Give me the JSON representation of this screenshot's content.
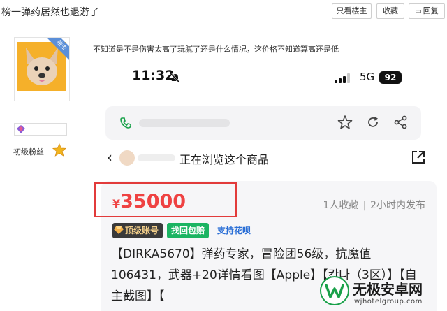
{
  "topbar": {
    "title": "榜一弹药居然也退游了",
    "only_op_label": "只看楼主",
    "favorite_label": "收藏",
    "reply_label": "回复"
  },
  "author": {
    "op_badge": "楼主",
    "level_label": "初级粉丝"
  },
  "post": {
    "text": "不知道是不是伤害太高了玩腻了还是什么情况，这价格不知道算高还是低"
  },
  "screenshot": {
    "status": {
      "time": "11:32",
      "network": "5G",
      "battery": "92"
    },
    "browse_text": "正在浏览这个商品",
    "product": {
      "currency": "¥",
      "price": "35000",
      "favorites": "1人收藏",
      "posted": "2小时内发布",
      "tags": [
        "顶级账号",
        "找回包赔",
        "支持花呗"
      ],
      "description": "【DIRKA5670】弹药专家，冒险团56级，抗魔值106431，武器+20详情看图【Apple】【칸나（3区）】【自主截图】【"
    }
  },
  "watermark": {
    "name": "无极安卓网",
    "url": "wjhotelgroup.com"
  },
  "colors": {
    "price_red": "#ef4242",
    "highlight_box": "#e23b3b",
    "tag_green": "#1bb462",
    "tag_blue": "#2b6fd6",
    "op_badge_blue": "#5b8fd8"
  }
}
